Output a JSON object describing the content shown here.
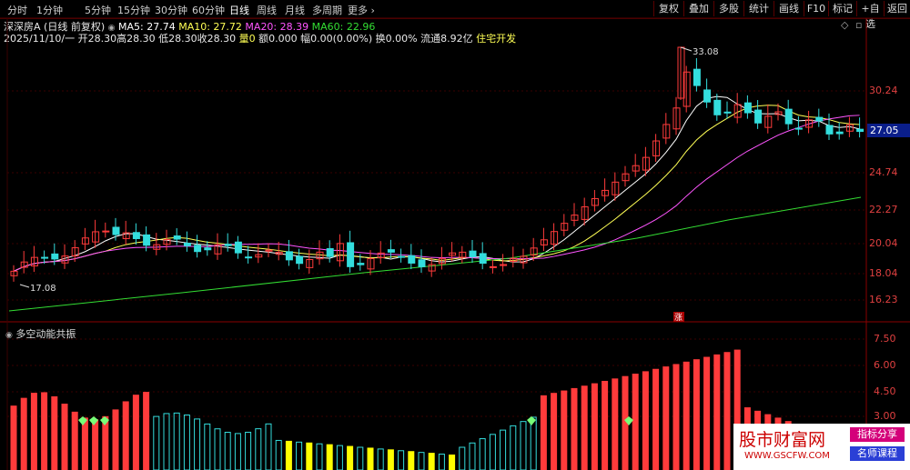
{
  "toolbar": {
    "periods": [
      "分时",
      "1分钟",
      "5分钟",
      "15分钟",
      "30分钟",
      "60分钟",
      "日线",
      "周线",
      "月线",
      "多周期",
      "更多"
    ],
    "active_period": "日线",
    "buttons": [
      "复权",
      "叠加",
      "多股",
      "统计",
      "画线",
      "F10",
      "标记",
      "+自选",
      "返回"
    ]
  },
  "stock": {
    "name": "深深房A",
    "mode": "(日线 前复权)",
    "ma5_label": "MA5: 27.74",
    "ma10_label": "MA10: 27.72",
    "ma20_label": "MA20: 28.39",
    "ma60_label": "MA60: 22.96",
    "date": "2025/11/10/一",
    "open": "开28.30",
    "high": "高28.30",
    "low": "低28.30",
    "close": "收28.30",
    "volume": "量0",
    "amount": "额0.000",
    "change": "幅0.00(0.00%)",
    "turnover": "换0.00%",
    "float": "流通8.92亿",
    "sector": "住宅开发"
  },
  "price_axis": [
    "30.24",
    "24.74",
    "22.27",
    "20.04",
    "18.04",
    "16.23"
  ],
  "current_price": "27.05",
  "annotations": {
    "high": "33.08",
    "low": "17.08",
    "limit_up": "涨"
  },
  "indicator": {
    "name": "多空动能共振",
    "axis": [
      "7.50",
      "6.00",
      "4.50",
      "3.00"
    ]
  },
  "colors": {
    "up": "#ff3b3b",
    "down": "#33dddd",
    "ma5": "#ffffff",
    "ma10": "#ffff55",
    "ma20": "#ff55ff",
    "ma60": "#33dd33",
    "yellow_bar": "#ffff00",
    "grid": "#5a0000"
  },
  "watermark": {
    "title": "股市财富网",
    "url": "WWW.GSCFW.COM",
    "tag1": "指标分享",
    "tag2": "名师课程"
  }
}
